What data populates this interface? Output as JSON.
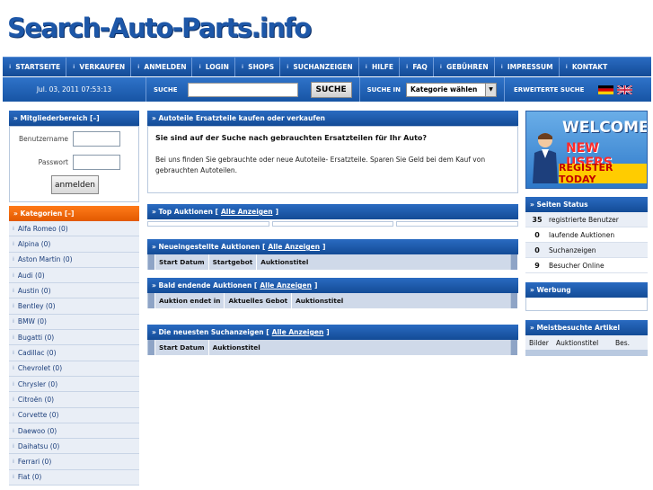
{
  "site": {
    "logo_text": "Search-Auto-Parts.info"
  },
  "topnav": [
    "STARTSEITE",
    "VERKAUFEN",
    "ANMELDEN",
    "LOGIN",
    "SHOPS",
    "SUCHANZEIGEN",
    "HILFE",
    "FAQ",
    "GEBÜHREN",
    "IMPRESSUM",
    "KONTAKT"
  ],
  "searchbar": {
    "date": "Jul. 03, 2011 07:53:13",
    "search_label": "SUCHE",
    "search_value": "",
    "search_button": "SUCHE",
    "search_in_label": "SUCHE IN",
    "category_select": "Kategorie wählen",
    "advanced": "ERWEITERTE SUCHE"
  },
  "member": {
    "title": "» Mitgliederbereich [–]",
    "username_label": "Benutzername",
    "password_label": "Passwort",
    "login_button": "anmelden"
  },
  "categories": {
    "title": "» Kategorien [–]",
    "items": [
      "Alfa Romeo (0)",
      "Alpina (0)",
      "Aston Martin (0)",
      "Audi (0)",
      "Austin (0)",
      "Bentley (0)",
      "BMW (0)",
      "Bugatti (0)",
      "Cadillac (0)",
      "Chevrolet (0)",
      "Chrysler (0)",
      "Citroën (0)",
      "Corvette (0)",
      "Daewoo (0)",
      "Daihatsu (0)",
      "Ferrari (0)",
      "Fiat (0)"
    ]
  },
  "intro": {
    "title": "» Autoteile Ersatzteile kaufen oder verkaufen",
    "question": "Sie sind auf der Suche nach gebrauchten Ersatzteilen für Ihr Auto?",
    "text": "Bei uns finden Sie gebrauchte oder neue Autoteile- Ersatzteile. Sparen Sie Geld bei dem Kauf von gebrauchten Autoteilen."
  },
  "sections": {
    "top": {
      "title": "» Top Auktionen [",
      "link": "Alle Anzeigen",
      "close": "]"
    },
    "new": {
      "title": "» Neueingestellte Auktionen [",
      "link": "Alle Anzeigen",
      "close": "]",
      "columns": [
        "Start Datum",
        "Startgebot",
        "Auktionstitel"
      ]
    },
    "ending": {
      "title": "» Bald endende Auktionen [",
      "link": "Alle Anzeigen",
      "close": "]",
      "columns": [
        "Auktion endet in",
        "Aktuelles Gebot",
        "Auktionstitel"
      ]
    },
    "wanted": {
      "title": "» Die neuesten Suchanzeigen [",
      "link": "Alle Anzeigen",
      "close": "]",
      "columns": [
        "Start Datum",
        "Auktionstitel"
      ]
    }
  },
  "banner": {
    "line1": "WELCOME",
    "line2": "NEW USERS",
    "line3": "REGISTER TODAY"
  },
  "status": {
    "title": "» Seiten Status",
    "rows": [
      {
        "num": "35",
        "label": "registrierte Benutzer"
      },
      {
        "num": "0",
        "label": "laufende Auktionen"
      },
      {
        "num": "0",
        "label": "Suchanzeigen"
      },
      {
        "num": "9",
        "label": "Besucher Online"
      }
    ]
  },
  "ads": {
    "title": "» Werbung"
  },
  "popular": {
    "title": "» Meistbesuchte Artikel",
    "columns": [
      "Bilder",
      "Auktionstitel",
      "Bes."
    ]
  },
  "colors": {
    "nav_blue": "#1d57a8",
    "accent_orange": "#e25a00"
  }
}
